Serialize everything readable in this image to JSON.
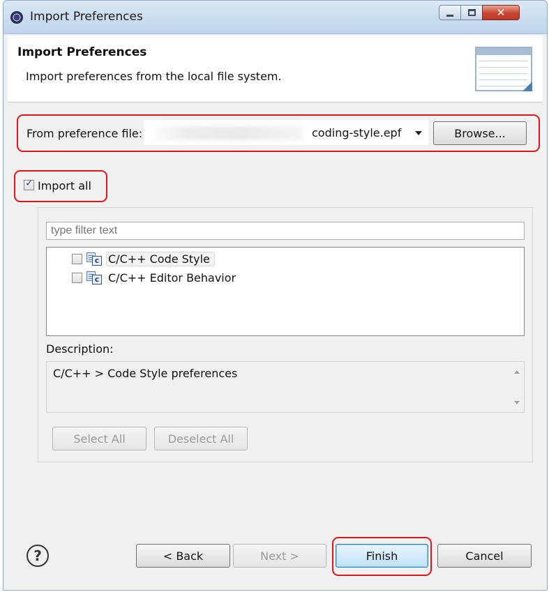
{
  "window": {
    "title": "Import Preferences"
  },
  "banner": {
    "title": "Import Preferences",
    "description": "Import preferences from the local file system."
  },
  "file": {
    "label": "From preference file:",
    "value": "coding-style.epf",
    "browse_label": "Browse..."
  },
  "import_all": {
    "label": "Import all",
    "checked": true
  },
  "filter": {
    "placeholder": "type filter text"
  },
  "tree": {
    "items": [
      {
        "label": "C/C++ Code Style",
        "checked": false,
        "icon": "cpp-settings-icon"
      },
      {
        "label": "C/C++ Editor Behavior",
        "checked": false,
        "icon": "cpp-settings-icon"
      }
    ]
  },
  "description": {
    "label": "Description:",
    "text": "C/C++ > Code Style preferences"
  },
  "selection_buttons": {
    "select_all": "Select All",
    "deselect_all": "Deselect All"
  },
  "footer": {
    "back": "< Back",
    "next": "Next >",
    "finish": "Finish",
    "cancel": "Cancel"
  },
  "colors": {
    "highlight": "#e0141b",
    "titlebar": "#c9dcee"
  }
}
